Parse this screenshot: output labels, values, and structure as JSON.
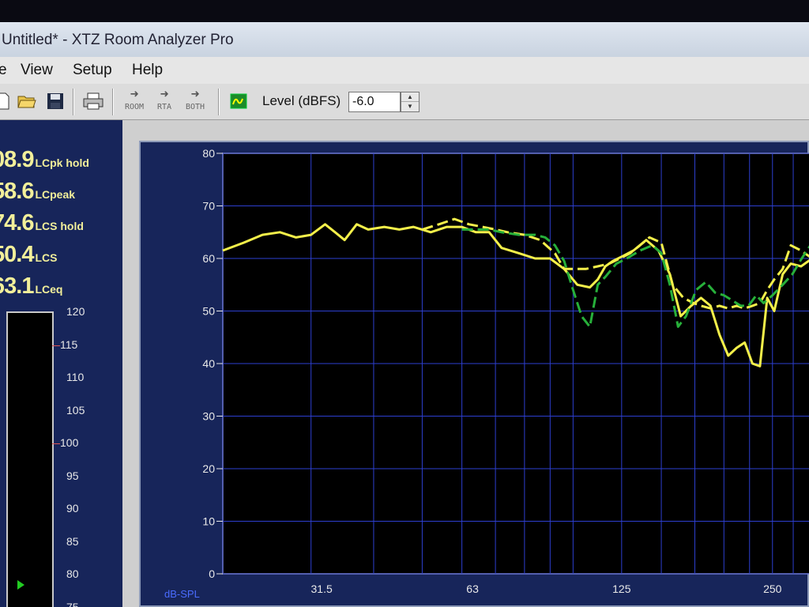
{
  "window": {
    "title": "Untitled* - XTZ Room Analyzer Pro"
  },
  "menu": {
    "items": [
      "e",
      "View",
      "Setup",
      "Help"
    ]
  },
  "toolbar": {
    "mode_buttons": [
      "ROOM",
      "RTA",
      "BOTH"
    ],
    "level_label": "Level (dBFS)",
    "level_value": "-6.0"
  },
  "readouts": [
    {
      "value": "08.9",
      "label": "LCpk hold"
    },
    {
      "value": "58.6",
      "label": "LCpeak"
    },
    {
      "value": "74.6",
      "label": "LCS hold"
    },
    {
      "value": "50.4",
      "label": "LCS"
    },
    {
      "value": "63.1",
      "label": "LCeq"
    }
  ],
  "meter": {
    "ticks": [
      "120",
      "115",
      "110",
      "105",
      "100",
      "95",
      "90",
      "85",
      "80",
      "75"
    ],
    "marked_ticks": [
      "115",
      "100"
    ]
  },
  "colors": {
    "panel": "#17255a",
    "plot_bg": "#000000",
    "grid": "#2d3fd0",
    "series_solid": "#f4f04a",
    "series_dashed_yellow": "#f4f04a",
    "series_dashed_green": "#27b03a"
  },
  "icons": [
    "document-icon",
    "open-folder-icon",
    "save-disk-icon",
    "printer-icon",
    "arrow-right-icon",
    "generator-icon"
  ],
  "chart_data": {
    "type": "line",
    "xscale": "log",
    "xlim": [
      20,
      300
    ],
    "ylim": [
      0,
      80
    ],
    "ylabel": "dB-SPL",
    "y_ticks": [
      0,
      10,
      20,
      30,
      40,
      50,
      60,
      70,
      80
    ],
    "x_ticks": [
      "31.5",
      "63",
      "125",
      "250"
    ],
    "x_tick_values": [
      31.5,
      63,
      125,
      250
    ],
    "grid": true,
    "series": [
      {
        "style": "solid",
        "color": "#f4f04a",
        "x": [
          20,
          22,
          24,
          26,
          28,
          30,
          32,
          33.5,
          35,
          37,
          39,
          42,
          45,
          48,
          52,
          56,
          60,
          64,
          68,
          72,
          78,
          84,
          90,
          96,
          102,
          108,
          112,
          116,
          120,
          126,
          132,
          140,
          148,
          156,
          164,
          172,
          180,
          188,
          196,
          204,
          212,
          220,
          228,
          236,
          244,
          252,
          262,
          272,
          285,
          300
        ],
        "y": [
          61.5,
          63,
          64.5,
          65,
          64,
          64.5,
          66.5,
          65,
          63.5,
          66.5,
          65.5,
          66,
          65.5,
          66,
          65,
          66,
          66,
          65,
          65,
          62,
          61,
          60,
          60,
          58,
          55,
          54.5,
          56,
          58.5,
          59.5,
          60.5,
          61.5,
          63.5,
          61.5,
          57,
          49,
          51,
          52.5,
          51,
          45.5,
          41.5,
          43,
          44,
          40,
          39.5,
          52.5,
          50,
          57,
          59,
          58.5,
          60
        ]
      },
      {
        "style": "dashed",
        "color": "#f4f04a",
        "x": [
          50,
          54,
          58,
          62,
          66,
          70,
          74,
          80,
          86,
          92,
          96,
          100,
          106,
          112,
          118,
          124,
          130,
          136,
          142,
          150,
          158,
          166,
          174,
          180,
          188,
          196,
          204,
          212,
          220,
          228,
          236,
          244,
          252,
          262,
          272,
          285,
          300
        ],
        "y": [
          65.5,
          66.5,
          67.5,
          66.5,
          66,
          65.5,
          65,
          64.5,
          63.5,
          61,
          58,
          58,
          58,
          58.5,
          59,
          60,
          61,
          62.5,
          64,
          63,
          55,
          52.5,
          51.5,
          51,
          50.5,
          51,
          50.5,
          51,
          50.5,
          51,
          51.5,
          54,
          56,
          58,
          62.5,
          61.5,
          60
        ]
      },
      {
        "style": "dashed",
        "color": "#27b03a",
        "x": [
          60,
          64,
          68,
          72,
          78,
          84,
          88,
          92,
          96,
          100,
          104,
          108,
          112,
          116,
          122,
          128,
          136,
          144,
          150,
          156,
          162,
          168,
          176,
          184,
          192,
          200,
          208,
          216,
          224,
          232,
          240,
          250,
          262,
          274,
          286,
          300
        ],
        "y": [
          65.5,
          65.5,
          65.5,
          65,
          64.5,
          64.5,
          64,
          62.5,
          59.5,
          54,
          49,
          47,
          55,
          56.5,
          59,
          60,
          61.5,
          62.5,
          61,
          55,
          47,
          49,
          54,
          55.5,
          53.5,
          53,
          52,
          51,
          51,
          53,
          51.5,
          53,
          55,
          57,
          60,
          63
        ]
      }
    ]
  },
  "plot_gap_top": []
}
